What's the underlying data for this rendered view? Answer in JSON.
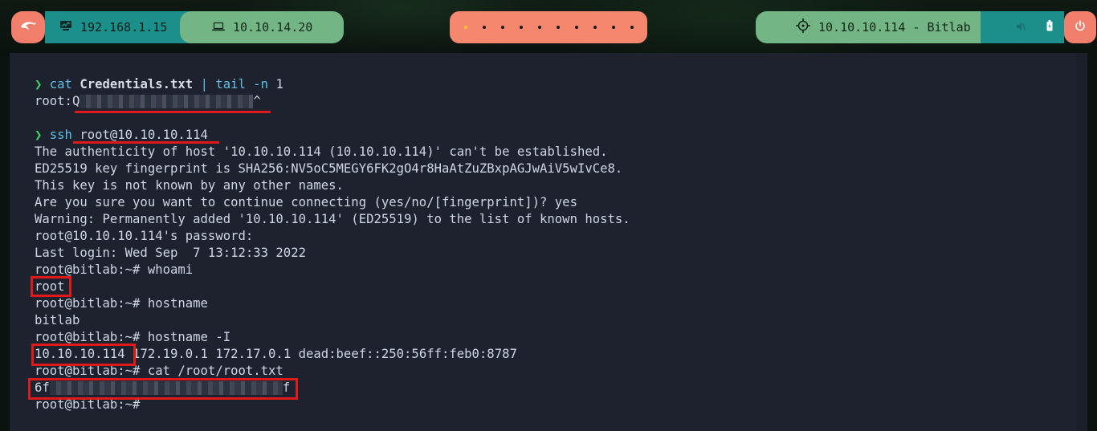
{
  "topbar": {
    "local_ip": "192.168.1.15",
    "vpn_ip": "10.10.14.20",
    "target": "10.10.10.114 - Bitlab",
    "workspaces": [
      true,
      false,
      false,
      false,
      false,
      false,
      false,
      false,
      false,
      false
    ],
    "icons": {
      "kali": "kali-dragon-icon",
      "local": "network-monitor-icon",
      "vpn": "laptop-icon",
      "target": "crosshair-target-icon",
      "speaker": "speaker-icon",
      "battery": "battery-icon",
      "power": "power-icon"
    },
    "colors": {
      "coral": "#f27f6c",
      "teal": "#1d8f8a",
      "green": "#73b584",
      "workspace_active": "#f0c431"
    }
  },
  "terminal": {
    "colors": {
      "background": "#1e222f",
      "text": "#cfd6e3",
      "prompt_arrow": "#42d26a",
      "command": "#5ec1e6",
      "highlight": "#e01a1a"
    },
    "cmd1": {
      "prompt": "❯",
      "command": "cat",
      "file": "Credentials.txt",
      "pipe": "|",
      "tail": "tail",
      "flag": "-n",
      "arg": "1"
    },
    "out1": {
      "prefix": "root:Q",
      "suffix": "^"
    },
    "cmd2": {
      "prompt": "❯",
      "command": "ssh",
      "arg": "root@10.10.10.114"
    },
    "ssh_output": [
      "The authenticity of host '10.10.10.114 (10.10.10.114)' can't be established.",
      "ED25519 key fingerprint is SHA256:NV5oC5MEGY6FK2gO4r8HaAtZuZBxpAGJwAiV5wIvCe8.",
      "This key is not known by any other names.",
      "Are you sure you want to continue connecting (yes/no/[fingerprint])? yes",
      "Warning: Permanently added '10.10.10.114' (ED25519) to the list of known hosts.",
      "root@10.10.10.114's password: ",
      "Last login: Wed Sep  7 13:12:33 2022",
      "root@bitlab:~# whoami",
      "root",
      "root@bitlab:~# hostname",
      "bitlab",
      "root@bitlab:~# hostname -I"
    ],
    "ip_line": {
      "first": "10.10.10.114",
      "rest": " 172.19.0.1 172.17.0.1 dead:beef::250:56ff:feb0:8787"
    },
    "cat_root": "root@bitlab:~# cat /root/root.txt",
    "flag": {
      "prefix": "6f",
      "suffix": "f"
    },
    "final_prompt": "root@bitlab:~# "
  }
}
